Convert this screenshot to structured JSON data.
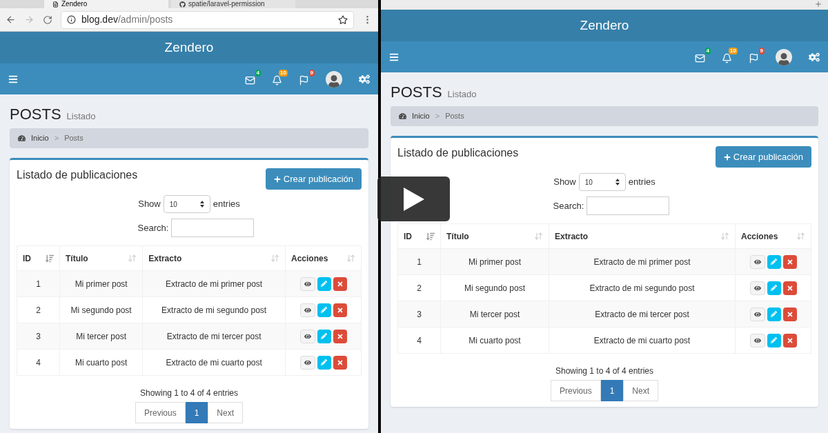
{
  "panes": [
    {
      "kind": "chrome",
      "tabs": [
        {
          "title": "Zendero",
          "selected": true
        },
        {
          "title": "spatie/laravel-permission",
          "selected": false
        }
      ],
      "url_host": "blog.dev",
      "url_path": "/admin/posts",
      "app": {
        "brand": "Zendero",
        "badges": [
          {
            "count": "4",
            "color": "#00a65a"
          },
          {
            "count": "10",
            "color": "#f39c12"
          },
          {
            "count": "9",
            "color": "#dd4b39"
          }
        ],
        "title": "POSTS",
        "subtitle": "Listado",
        "breadcrumb": [
          "Inicio",
          "Posts"
        ],
        "separator": ">",
        "box_title": "Listado de publicaciones",
        "create_button": "Crear publicación",
        "show_label": "Show",
        "page_size": "10",
        "entries_label": "entries",
        "search_label": "Search:",
        "columns": [
          {
            "label": "ID",
            "sorted": true
          },
          {
            "label": "Título",
            "sorted": false
          },
          {
            "label": "Extracto",
            "sorted": false
          },
          {
            "label": "Acciones",
            "sorted": false
          }
        ],
        "rows": [
          {
            "id": "1",
            "title": "Mi primer post",
            "excerpt": "Extracto de mi primer post"
          },
          {
            "id": "2",
            "title": "Mi segundo post",
            "excerpt": "Extracto de mi segundo post"
          },
          {
            "id": "3",
            "title": "Mi tercer post",
            "excerpt": "Extracto de mi tercer post"
          },
          {
            "id": "4",
            "title": "Mi cuarto post",
            "excerpt": "Extracto de mi cuarto post"
          }
        ],
        "info": "Showing 1 to 4 of 4 entries",
        "pagination": [
          {
            "label": "Previous",
            "selected": false
          },
          {
            "label": "1",
            "selected": true
          },
          {
            "label": "Next",
            "selected": false
          }
        ]
      }
    },
    {
      "kind": "safari",
      "app": {
        "brand": "Zendero",
        "badges": [
          {
            "count": "4",
            "color": "#00a65a"
          },
          {
            "count": "10",
            "color": "#f39c12"
          },
          {
            "count": "9",
            "color": "#dd4b39"
          }
        ],
        "title": "POSTS",
        "subtitle": "Listado",
        "breadcrumb": [
          "Inicio",
          "Posts"
        ],
        "separator": ">",
        "box_title": "Listado de publicaciones",
        "create_button": "Crear publicación",
        "show_label": "Show",
        "page_size": "10",
        "entries_label": "entries",
        "search_label": "Search:",
        "columns": [
          {
            "label": "ID",
            "sorted": true
          },
          {
            "label": "Título",
            "sorted": false
          },
          {
            "label": "Extracto",
            "sorted": false
          },
          {
            "label": "Acciones",
            "sorted": false
          }
        ],
        "rows": [
          {
            "id": "1",
            "title": "Mi primer post",
            "excerpt": "Extracto de mi primer post"
          },
          {
            "id": "2",
            "title": "Mi segundo post",
            "excerpt": "Extracto de mi segundo post"
          },
          {
            "id": "3",
            "title": "Mi tercer post",
            "excerpt": "Extracto de mi tercer post"
          },
          {
            "id": "4",
            "title": "Mi cuarto post",
            "excerpt": "Extracto de mi cuarto post"
          }
        ],
        "info": "Showing 1 to 4 of 4 entries",
        "pagination": [
          {
            "label": "Previous",
            "selected": false
          },
          {
            "label": "1",
            "selected": true
          },
          {
            "label": "Next",
            "selected": false
          }
        ]
      }
    }
  ]
}
